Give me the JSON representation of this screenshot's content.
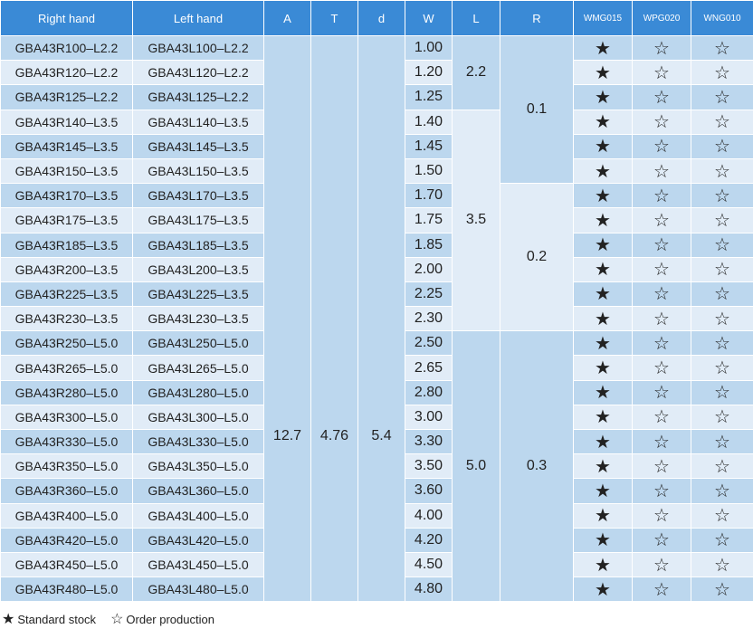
{
  "headers": {
    "right": "Right hand",
    "left": "Left hand",
    "a": "A",
    "t": "T",
    "d": "d",
    "w": "W",
    "l": "L",
    "r": "R",
    "g1": "WMG015",
    "g2": "WPG020",
    "g3": "WNG010"
  },
  "shared": {
    "a": "12.7",
    "t": "4.76",
    "d": "5.4"
  },
  "l_groups": [
    "2.2",
    "3.5",
    "5.0"
  ],
  "r_groups": [
    "0.1",
    "0.2",
    "0.3"
  ],
  "rows": [
    {
      "right": "GBA43R100–L2.2",
      "left": "GBA43L100–L2.2",
      "w": "1.00",
      "g1": "★",
      "g2": "☆",
      "g3": "☆"
    },
    {
      "right": "GBA43R120–L2.2",
      "left": "GBA43L120–L2.2",
      "w": "1.20",
      "g1": "★",
      "g2": "☆",
      "g3": "☆"
    },
    {
      "right": "GBA43R125–L2.2",
      "left": "GBA43L125–L2.2",
      "w": "1.25",
      "g1": "★",
      "g2": "☆",
      "g3": "☆"
    },
    {
      "right": "GBA43R140–L3.5",
      "left": "GBA43L140–L3.5",
      "w": "1.40",
      "g1": "★",
      "g2": "☆",
      "g3": "☆"
    },
    {
      "right": "GBA43R145–L3.5",
      "left": "GBA43L145–L3.5",
      "w": "1.45",
      "g1": "★",
      "g2": "☆",
      "g3": "☆"
    },
    {
      "right": "GBA43R150–L3.5",
      "left": "GBA43L150–L3.5",
      "w": "1.50",
      "g1": "★",
      "g2": "☆",
      "g3": "☆"
    },
    {
      "right": "GBA43R170–L3.5",
      "left": "GBA43L170–L3.5",
      "w": "1.70",
      "g1": "★",
      "g2": "☆",
      "g3": "☆"
    },
    {
      "right": "GBA43R175–L3.5",
      "left": "GBA43L175–L3.5",
      "w": "1.75",
      "g1": "★",
      "g2": "☆",
      "g3": "☆"
    },
    {
      "right": "GBA43R185–L3.5",
      "left": "GBA43L185–L3.5",
      "w": "1.85",
      "g1": "★",
      "g2": "☆",
      "g3": "☆"
    },
    {
      "right": "GBA43R200–L3.5",
      "left": "GBA43L200–L3.5",
      "w": "2.00",
      "g1": "★",
      "g2": "☆",
      "g3": "☆"
    },
    {
      "right": "GBA43R225–L3.5",
      "left": "GBA43L225–L3.5",
      "w": "2.25",
      "g1": "★",
      "g2": "☆",
      "g3": "☆"
    },
    {
      "right": "GBA43R230–L3.5",
      "left": "GBA43L230–L3.5",
      "w": "2.30",
      "g1": "★",
      "g2": "☆",
      "g3": "☆"
    },
    {
      "right": "GBA43R250–L5.0",
      "left": "GBA43L250–L5.0",
      "w": "2.50",
      "g1": "★",
      "g2": "☆",
      "g3": "☆"
    },
    {
      "right": "GBA43R265–L5.0",
      "left": "GBA43L265–L5.0",
      "w": "2.65",
      "g1": "★",
      "g2": "☆",
      "g3": "☆"
    },
    {
      "right": "GBA43R280–L5.0",
      "left": "GBA43L280–L5.0",
      "w": "2.80",
      "g1": "★",
      "g2": "☆",
      "g3": "☆"
    },
    {
      "right": "GBA43R300–L5.0",
      "left": "GBA43L300–L5.0",
      "w": "3.00",
      "g1": "★",
      "g2": "☆",
      "g3": "☆"
    },
    {
      "right": "GBA43R330–L5.0",
      "left": "GBA43L330–L5.0",
      "w": "3.30",
      "g1": "★",
      "g2": "☆",
      "g3": "☆"
    },
    {
      "right": "GBA43R350–L5.0",
      "left": "GBA43L350–L5.0",
      "w": "3.50",
      "g1": "★",
      "g2": "☆",
      "g3": "☆"
    },
    {
      "right": "GBA43R360–L5.0",
      "left": "GBA43L360–L5.0",
      "w": "3.60",
      "g1": "★",
      "g2": "☆",
      "g3": "☆"
    },
    {
      "right": "GBA43R400–L5.0",
      "left": "GBA43L400–L5.0",
      "w": "4.00",
      "g1": "★",
      "g2": "☆",
      "g3": "☆"
    },
    {
      "right": "GBA43R420–L5.0",
      "left": "GBA43L420–L5.0",
      "w": "4.20",
      "g1": "★",
      "g2": "☆",
      "g3": "☆"
    },
    {
      "right": "GBA43R450–L5.0",
      "left": "GBA43L450–L5.0",
      "w": "4.50",
      "g1": "★",
      "g2": "☆",
      "g3": "☆"
    },
    {
      "right": "GBA43R480–L5.0",
      "left": "GBA43L480–L5.0",
      "w": "4.80",
      "g1": "★",
      "g2": "☆",
      "g3": "☆"
    }
  ],
  "legend": {
    "filled_icon": "★",
    "filled_label": "Standard stock",
    "outline_icon": "☆",
    "outline_label": "Order production"
  },
  "colors": {
    "header": "#3a8ad6",
    "dark_row": "#bcd7ee",
    "light_row": "#e1ecf7"
  }
}
